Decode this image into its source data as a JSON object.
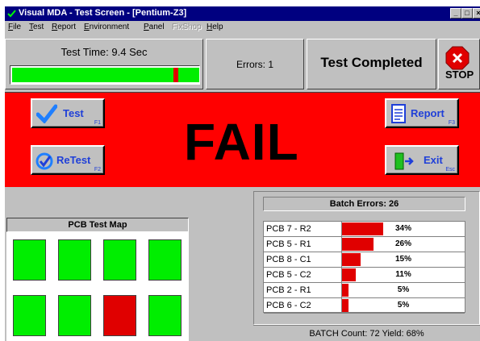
{
  "window": {
    "title": "Visual MDA - Test Screen - [Pentium-Z3]",
    "controls": {
      "minimize": "_",
      "maximize": "□",
      "close": "×"
    }
  },
  "menu": [
    {
      "label": "File",
      "accel": "F",
      "rest": "ile",
      "enabled": true
    },
    {
      "label": "Test",
      "accel": "T",
      "rest": "est",
      "enabled": true
    },
    {
      "label": "Report",
      "accel": "R",
      "rest": "eport",
      "enabled": true
    },
    {
      "label": "Environment",
      "accel": "E",
      "rest": "nvironment",
      "enabled": true
    },
    {
      "label": "Panel",
      "accel": "P",
      "rest": "anel",
      "enabled": true
    },
    {
      "label": "FixShop",
      "accel": "",
      "rest": "FixShop",
      "enabled": false
    },
    {
      "label": "Help",
      "accel": "H",
      "rest": "elp",
      "enabled": true
    }
  ],
  "status_bar": {
    "test_time_label": "Test Time: 9.4 Sec",
    "progress_fraction": 0.86,
    "errors_label": "Errors: 1",
    "status_text": "Test Completed",
    "stop_label": "STOP"
  },
  "result": {
    "text": "FAIL",
    "color": "#ff0000"
  },
  "buttons": {
    "test": {
      "label": "Test",
      "fkey": "F1"
    },
    "retest": {
      "label": "ReTest",
      "fkey": "F2"
    },
    "report": {
      "label": "Report",
      "fkey": "F3"
    },
    "exit": {
      "label": "Exit",
      "fkey": "Esc"
    }
  },
  "pcb_map": {
    "title": "PCB Test Map",
    "colors": {
      "pass": "#00ee00",
      "fail": "#e00000"
    },
    "cells": [
      {
        "row": 0,
        "col": 0,
        "status": "pass"
      },
      {
        "row": 0,
        "col": 1,
        "status": "pass"
      },
      {
        "row": 0,
        "col": 2,
        "status": "pass"
      },
      {
        "row": 0,
        "col": 3,
        "status": "pass"
      },
      {
        "row": 1,
        "col": 0,
        "status": "pass"
      },
      {
        "row": 1,
        "col": 1,
        "status": "pass"
      },
      {
        "row": 1,
        "col": 2,
        "status": "fail"
      },
      {
        "row": 1,
        "col": 3,
        "status": "pass"
      }
    ]
  },
  "batch": {
    "title": "Batch Errors: 26",
    "rows": [
      {
        "label": "PCB 7 - R2",
        "pct": "34%",
        "value": 34
      },
      {
        "label": "PCB 5 - R1",
        "pct": "26%",
        "value": 26
      },
      {
        "label": "PCB 8 - C1",
        "pct": "15%",
        "value": 15
      },
      {
        "label": "PCB 5 - C2",
        "pct": "11%",
        "value": 11
      },
      {
        "label": "PCB 2 - R1",
        "pct": "5%",
        "value": 5
      },
      {
        "label": "PCB 6 - C2",
        "pct": "5%",
        "value": 5
      }
    ],
    "footer": "BATCH Count: 72  Yield: 68%"
  }
}
